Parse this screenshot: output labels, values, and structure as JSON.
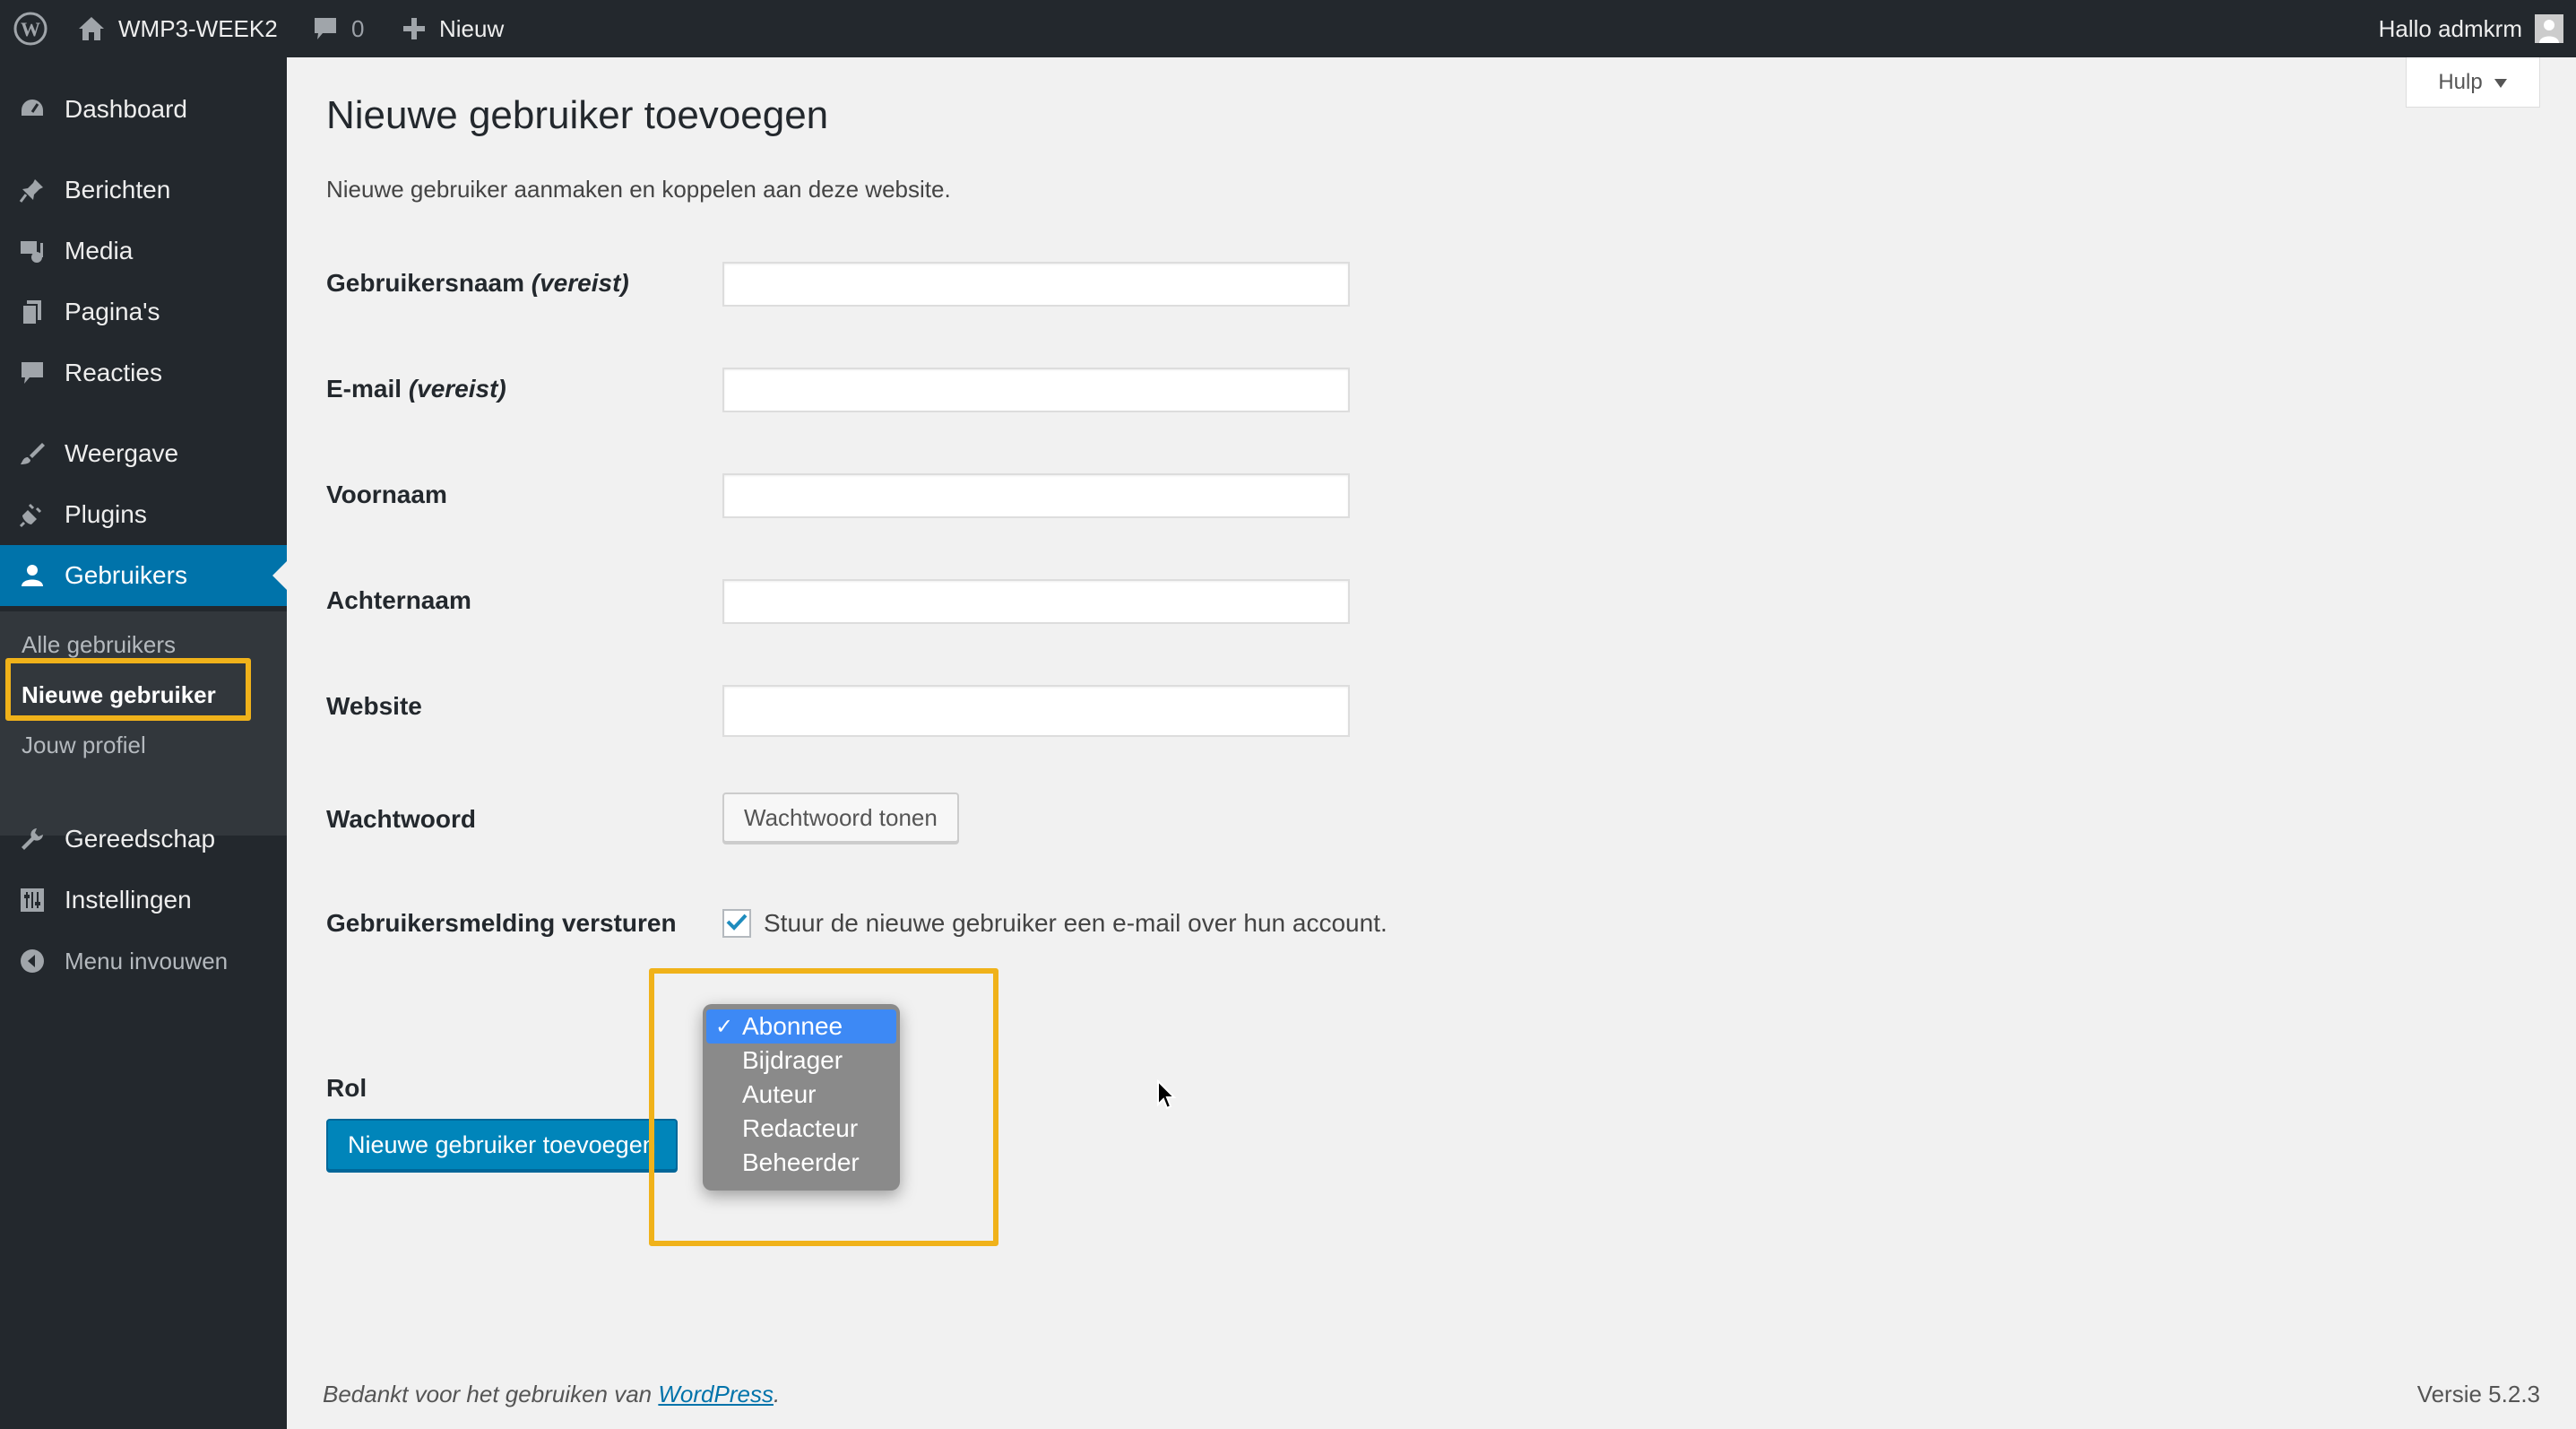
{
  "adminbar": {
    "site_name": "WMP3-WEEK2",
    "comments_count": "0",
    "new_label": "Nieuw",
    "greeting": "Hallo admkrm"
  },
  "sidebar": {
    "items": [
      {
        "label": "Dashboard",
        "icon": "dashboard-icon"
      },
      {
        "label": "Berichten",
        "icon": "pin-icon"
      },
      {
        "label": "Media",
        "icon": "media-icon"
      },
      {
        "label": "Pagina's",
        "icon": "pages-icon"
      },
      {
        "label": "Reacties",
        "icon": "comments-icon"
      },
      {
        "label": "Weergave",
        "icon": "appearance-icon"
      },
      {
        "label": "Plugins",
        "icon": "plugins-icon"
      },
      {
        "label": "Gebruikers",
        "icon": "users-icon"
      },
      {
        "label": "Gereedschap",
        "icon": "tools-icon"
      },
      {
        "label": "Instellingen",
        "icon": "settings-icon"
      },
      {
        "label": "Menu invouwen",
        "icon": "collapse-icon"
      }
    ],
    "submenu": [
      "Alle gebruikers",
      "Nieuwe gebruiker",
      "Jouw profiel"
    ]
  },
  "help_label": "Hulp",
  "page": {
    "title": "Nieuwe gebruiker toevoegen",
    "description": "Nieuwe gebruiker aanmaken en koppelen aan deze website."
  },
  "form": {
    "username_label": "Gebruikersnaam",
    "email_label": "E-mail",
    "required_note": "(vereist)",
    "firstname_label": "Voornaam",
    "lastname_label": "Achternaam",
    "website_label": "Website",
    "password_label": "Wachtwoord",
    "show_password_button": "Wachtwoord tonen",
    "notify_label": "Gebruikersmelding versturen",
    "notify_checkbox_text": "Stuur de nieuwe gebruiker een e-mail over hun account.",
    "notify_checked": true,
    "role_label": "Rol",
    "role_options": [
      "Abonnee",
      "Bijdrager",
      "Auteur",
      "Redacteur",
      "Beheerder"
    ],
    "role_selected": "Abonnee",
    "submit_button": "Nieuwe gebruiker toevoegen"
  },
  "footer": {
    "thanks_prefix": "Bedankt voor het gebruiken van",
    "thanks_link": "WordPress",
    "thanks_suffix": ".",
    "version": "Versie 5.2.3"
  },
  "colors": {
    "adminbar_bg": "#23282d",
    "accent": "#0073aa",
    "primary_button": "#0085ba",
    "highlight": "#f0b21a",
    "dropdown_selected": "#3d89f5"
  }
}
